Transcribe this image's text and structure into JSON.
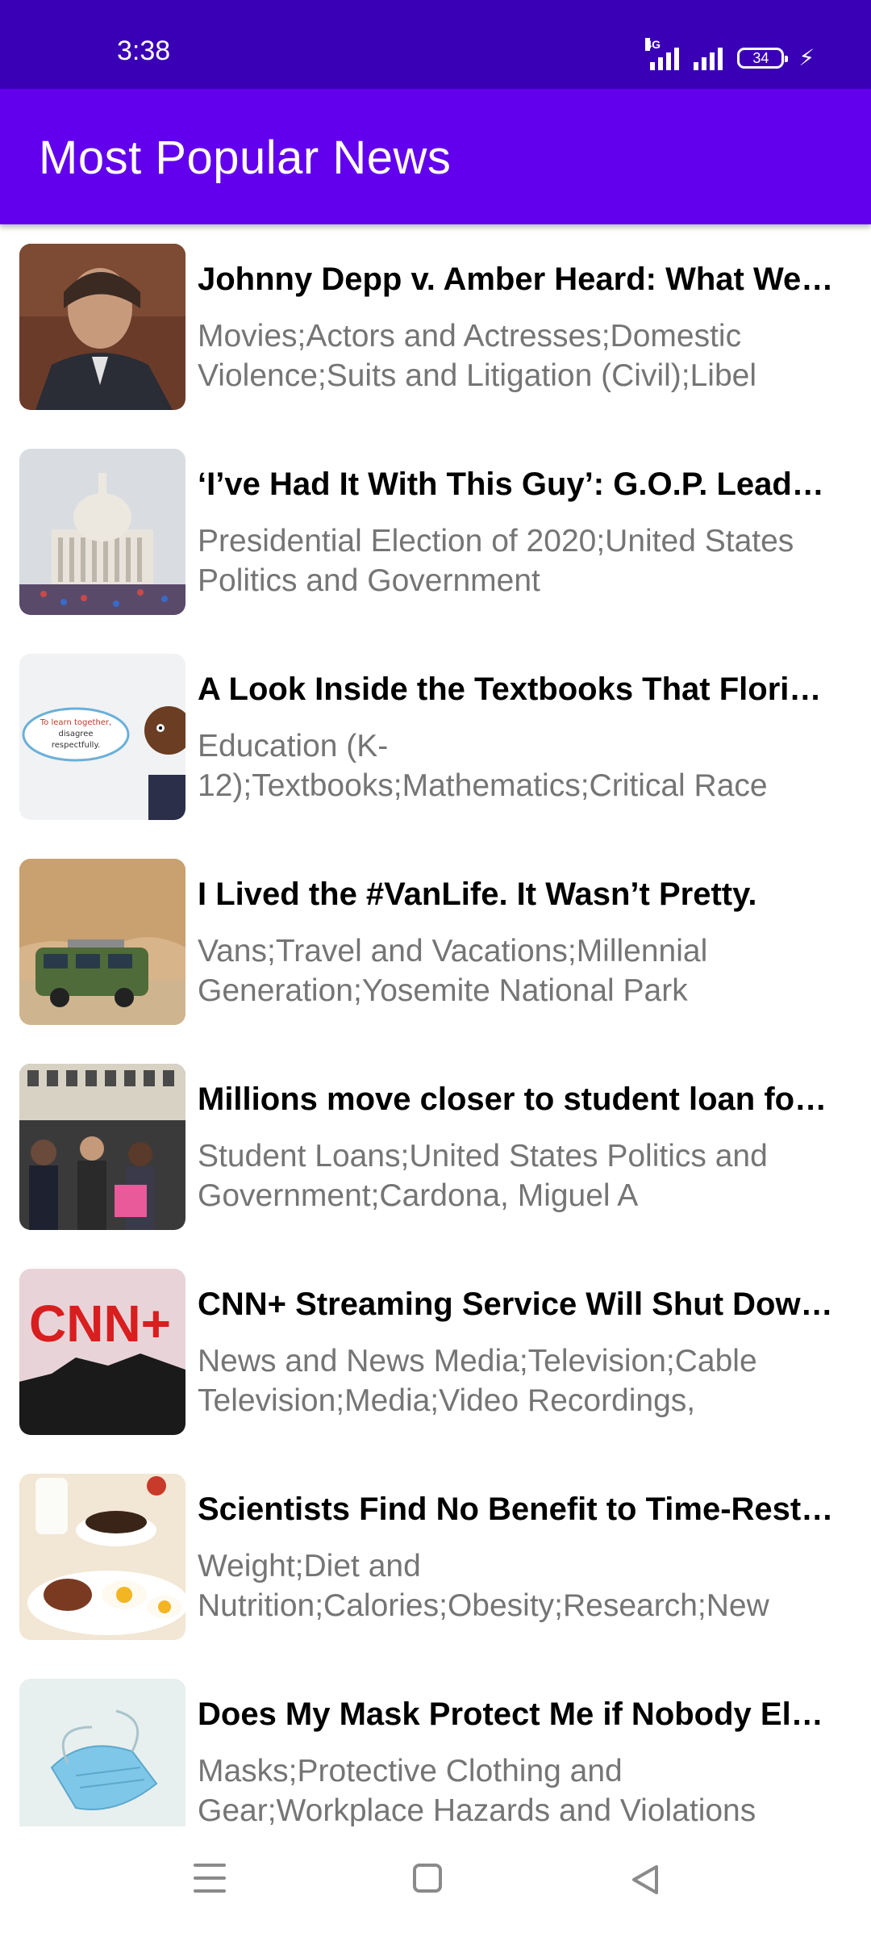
{
  "status_bar": {
    "time": "3:38",
    "network": "4G",
    "battery": "34",
    "icons": [
      "signal-4g-icon",
      "signal-icon",
      "battery-icon",
      "charging-bolt-icon"
    ]
  },
  "app_bar": {
    "title": "Most Popular News",
    "color": "#6200ee",
    "status_color": "#3a00b5"
  },
  "articles": [
    {
      "title": "Johnny Depp v. Amber Heard: What We Learned",
      "tags": "Movies;Actors and Actresses;Domestic Violence;Suits and Litigation (Civil);Libel"
    },
    {
      "title": "‘I’ve Had It With This Guy’: G.O.P. Leaders Privately Blasted Trump",
      "tags": "Presidential Election of 2020;United States Politics and Government"
    },
    {
      "title": "A Look Inside the Textbooks That Florida Rejected",
      "tags": "Education (K-12);Textbooks;Mathematics;Critical Race Theory"
    },
    {
      "title": "I Lived the #VanLife. It Wasn’t Pretty.",
      "tags": "Vans;Travel and Vacations;Millennial Generation;Yosemite National Park"
    },
    {
      "title": "Millions move closer to student loan forgiveness",
      "tags": "Student Loans;United States Politics and Government;Cardona, Miguel A"
    },
    {
      "title": "CNN+ Streaming Service Will Shut Down in April",
      "tags": "News and News Media;Television;Cable Television;Media;Video Recordings, Downloads and Streaming"
    },
    {
      "title": "Scientists Find No Benefit to Time-Restricted Eating",
      "tags": "Weight;Diet and Nutrition;Calories;Obesity;Research;New England Journal of Medicine"
    },
    {
      "title": "Does My Mask Protect Me if Nobody Else Is Wearing One?",
      "tags": "Masks;Protective Clothing and Gear;Workplace Hazards and Violations"
    }
  ],
  "thumb_labels": {
    "speech": "To learn together, disagree respectfully.",
    "cnn": "CNN+"
  },
  "nav_bar": {
    "icons": [
      "menu-icon",
      "home-icon",
      "back-icon"
    ]
  }
}
